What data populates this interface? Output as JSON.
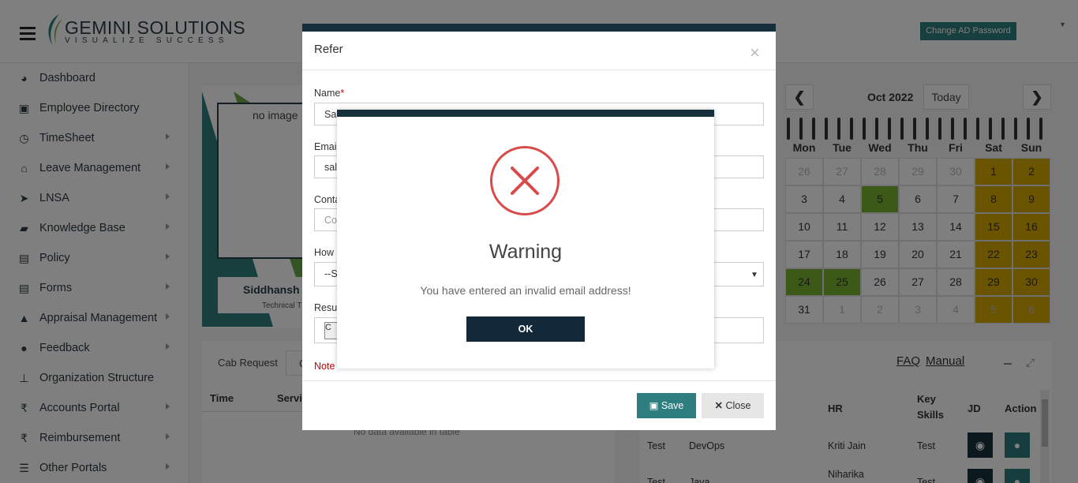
{
  "brand": {
    "name": "GEMINI SOLUTIONS",
    "tagline": "VISUALIZE SUCCESS"
  },
  "header": {
    "change_password": "Change AD Password"
  },
  "sidebar": {
    "items": [
      {
        "label": "Dashboard",
        "icon": "dashboard-icon",
        "glyph": "◕",
        "arrow": false
      },
      {
        "label": "Employee Directory",
        "icon": "address-book-icon",
        "glyph": "▣",
        "arrow": false
      },
      {
        "label": "TimeSheet",
        "icon": "clock-icon",
        "glyph": "◷",
        "arrow": true
      },
      {
        "label": "Leave Management",
        "icon": "home-icon",
        "glyph": "⌂",
        "arrow": true
      },
      {
        "label": "LNSA",
        "icon": "paper-plane-icon",
        "glyph": "➤",
        "arrow": true
      },
      {
        "label": "Knowledge Base",
        "icon": "folder-open-icon",
        "glyph": "▰",
        "arrow": true
      },
      {
        "label": "Policy",
        "icon": "file-icon",
        "glyph": "▤",
        "arrow": true
      },
      {
        "label": "Forms",
        "icon": "file-text-icon",
        "glyph": "▤",
        "arrow": true
      },
      {
        "label": "Appraisal Management",
        "icon": "graduation-cap-icon",
        "glyph": "▲",
        "arrow": true
      },
      {
        "label": "Feedback",
        "icon": "comments-icon",
        "glyph": "●",
        "arrow": true
      },
      {
        "label": "Organization Structure",
        "icon": "sitemap-icon",
        "glyph": "⊥",
        "arrow": false
      },
      {
        "label": "Accounts Portal",
        "icon": "rupee-icon",
        "glyph": "₹",
        "arrow": true
      },
      {
        "label": "Reimbursement",
        "icon": "rupee-icon",
        "glyph": "₹",
        "arrow": true
      },
      {
        "label": "Other Portals",
        "icon": "list-icon",
        "glyph": "☰",
        "arrow": true
      }
    ]
  },
  "profile": {
    "no_image": "no image",
    "name": "Siddhansh",
    "title": "Technical T"
  },
  "cab": {
    "label": "Cab Request",
    "select_value": "C",
    "col_time": "Time",
    "col_service": "Servic",
    "empty": "No data available in table"
  },
  "calendar": {
    "month": "Oct 2022",
    "today": "Today",
    "prev": "❮",
    "next": "❯",
    "days": [
      "Mon",
      "Tue",
      "Wed",
      "Thu",
      "Fri",
      "Sat",
      "Sun"
    ],
    "weeks": [
      [
        [
          "26",
          "o"
        ],
        [
          "27",
          "o"
        ],
        [
          "28",
          "o"
        ],
        [
          "29",
          "o"
        ],
        [
          "30",
          "o"
        ],
        [
          "1",
          "w"
        ],
        [
          "2",
          "w"
        ]
      ],
      [
        [
          "3",
          ""
        ],
        [
          "4",
          ""
        ],
        [
          "5",
          "g"
        ],
        [
          "6",
          ""
        ],
        [
          "7",
          ""
        ],
        [
          "8",
          "w"
        ],
        [
          "9",
          "w"
        ]
      ],
      [
        [
          "10",
          ""
        ],
        [
          "11",
          ""
        ],
        [
          "12",
          ""
        ],
        [
          "13",
          ""
        ],
        [
          "14",
          ""
        ],
        [
          "15",
          "w"
        ],
        [
          "16",
          "w"
        ]
      ],
      [
        [
          "17",
          ""
        ],
        [
          "18",
          ""
        ],
        [
          "19",
          ""
        ],
        [
          "20",
          ""
        ],
        [
          "21",
          ""
        ],
        [
          "22",
          "w"
        ],
        [
          "23",
          "w"
        ]
      ],
      [
        [
          "24",
          "g"
        ],
        [
          "25",
          "g"
        ],
        [
          "26",
          ""
        ],
        [
          "27",
          ""
        ],
        [
          "28",
          ""
        ],
        [
          "29",
          "w"
        ],
        [
          "30",
          "w"
        ]
      ],
      [
        [
          "31",
          ""
        ],
        [
          "1",
          "o"
        ],
        [
          "2",
          "o"
        ],
        [
          "3",
          "o"
        ],
        [
          "4",
          "o"
        ],
        [
          "5",
          "wo"
        ],
        [
          "6",
          "wo"
        ]
      ]
    ],
    "colors": {
      "weekend": "#d4a800",
      "holiday": "#79b32e",
      "other_month": "#bbbbbb"
    }
  },
  "vacancies": {
    "faq": "FAQ",
    "manual": "Manual",
    "headers": {
      "hr": "HR",
      "key_skills_1": "Key",
      "key_skills_2": "Skills",
      "jd": "JD",
      "action": "Action"
    },
    "rows": [
      {
        "name": "Test",
        "dept": "DevOps",
        "hr": "Kriti Jain",
        "skills": "Test"
      },
      {
        "name": "Test",
        "dept": "Java",
        "hr": "Niharika",
        "skills": "Test"
      }
    ]
  },
  "refer": {
    "title": "Refer",
    "close_x": "×",
    "name_label": "Name",
    "name_value": "Saloni Pacholi",
    "email_label": "Emai",
    "email_value": "sal",
    "contact_label": "Conta",
    "contact_placeholder": "Co",
    "how_label": "How",
    "how_value": "--S",
    "resume_label": "Resu",
    "choose_file": "C",
    "note": "Note",
    "save": "Save",
    "close": "Close"
  },
  "warning": {
    "title": "Warning",
    "message": "You have entered an invalid email address!",
    "ok": "OK"
  }
}
